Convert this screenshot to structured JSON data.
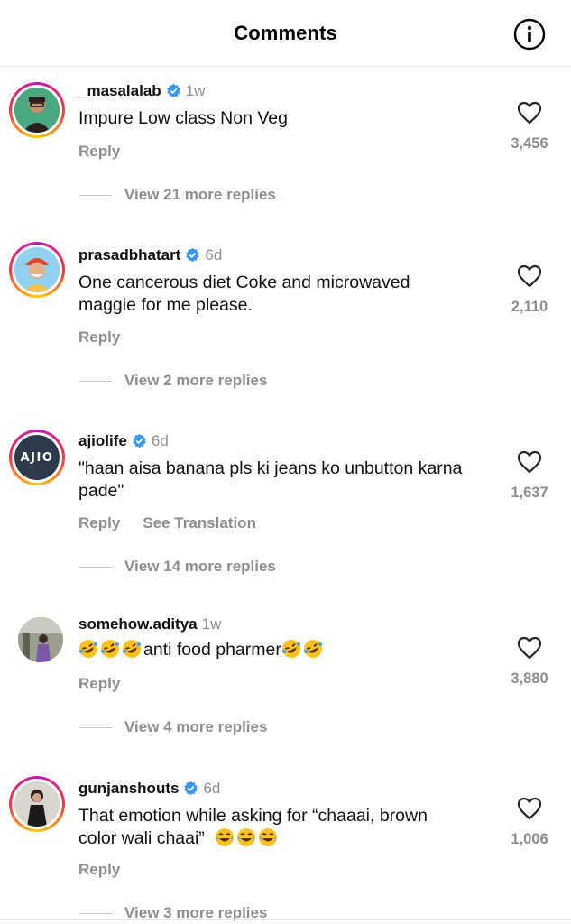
{
  "header": {
    "title": "Comments",
    "info_icon": "info-icon"
  },
  "comments": [
    {
      "username": "_masalalab",
      "verified": true,
      "time": "1w",
      "text": "Impure Low class Non Veg",
      "reply_label": "Reply",
      "likes": "3,456",
      "view_replies": "View 21 more replies"
    },
    {
      "username": "prasadbhatart",
      "verified": true,
      "time": "6d",
      "text": "One cancerous diet Coke and microwaved maggie for me please.",
      "reply_label": "Reply",
      "likes": "2,110",
      "view_replies": "View 2 more replies"
    },
    {
      "username": "ajiolife",
      "verified": true,
      "time": "6d",
      "text": "\"haan aisa banana pls ki jeans ko unbutton karna pade\"",
      "reply_label": "Reply",
      "translate_label": "See Translation",
      "avatar_text": "AJIO",
      "likes": "1,637",
      "view_replies": "View 14 more replies"
    },
    {
      "username": "somehow.aditya",
      "verified": false,
      "time": "1w",
      "text": "anti food pharmer",
      "reply_label": "Reply",
      "likes": "3,880",
      "view_replies": "View 4 more replies"
    },
    {
      "username": "gunjanshouts",
      "verified": true,
      "time": "6d",
      "text_line1": "That emotion while asking for “chaaai, brown",
      "text_line2": "color wali chaai”",
      "reply_label": "Reply",
      "likes": "1,006",
      "view_replies": "View 3 more replies"
    }
  ],
  "colors": {
    "muted": "#8e8e8e",
    "verified": "#3897f0",
    "like_icon": "#262626"
  }
}
